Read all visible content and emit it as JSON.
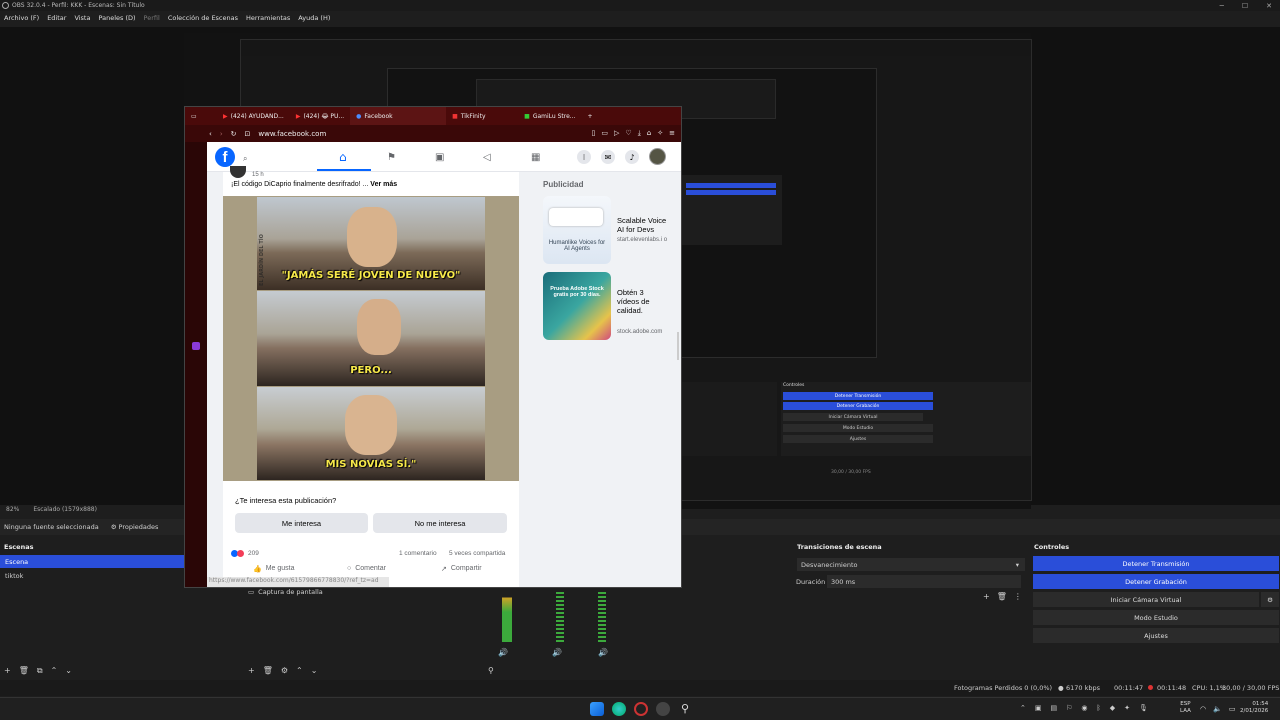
{
  "window": {
    "title": "OBS 32.0.4 - Perfil: KKK - Escenas: Sin Título"
  },
  "menu": [
    "Archivo (F)",
    "Editar",
    "Vista",
    "Paneles (D)",
    "Perfil",
    "Colección de Escenas",
    "Herramientas",
    "Ayuda (H)"
  ],
  "preview_toolbar": {
    "zoom": "82%",
    "scaling": "Escalado (1579x888)"
  },
  "browser": {
    "tabs": [
      "(424) AYUDAND...",
      "(424) 😂 PU...",
      "Facebook",
      "TikFinity",
      "GamiLu Stre..."
    ],
    "url": "www.facebook.com"
  },
  "post": {
    "time": "15 h",
    "text": "¡El código DiCaprio finalmente desrifrado! ...",
    "see_more": "Ver más",
    "captions": [
      "\"JAMÁS SERÉ JOVEN DE NUEVO\"",
      "PERO...",
      "MIS NOVIAS SÍ.\""
    ],
    "watermark": "EL JARDÍN DEL TÍO",
    "question": "¿Te interesa esta publicación?",
    "interested": "Me interesa",
    "not_interested": "No me interesa",
    "reactions": "209",
    "comments": "1 comentario",
    "shares": "5 veces compartida",
    "like": "Me gusta",
    "comment": "Comentar",
    "share": "Compartir",
    "link_preview": "https://www.facebook.com/61579866778830/?ref_tz=ad"
  },
  "ads": {
    "header": "Publicidad",
    "items": [
      {
        "title": "Scalable Voice AI for Devs",
        "source": "start.elevenlabs.i o",
        "img_text": "Humanlike Voices for AI Agents"
      },
      {
        "title": "Obtén 3 vídeos de calidad.",
        "source": "stock.adobe.com",
        "img_text": "Prueba Adobe Stock gratis por 30 días."
      }
    ]
  },
  "sources_bar": {
    "none_selected": "Ninguna fuente seleccionada",
    "properties": "Propiedades"
  },
  "scenes": {
    "header": "Escenas",
    "items": [
      "Escena",
      "tiktok"
    ]
  },
  "sources": {
    "item": "Captura de pantalla"
  },
  "transitions": {
    "header": "Transiciones de escena",
    "type": "Desvanecimiento",
    "duration_label": "Duración",
    "duration": "300 ms"
  },
  "controls": {
    "header": "Controles",
    "stop_stream": "Detener Transmisión",
    "stop_record": "Detener Grabación",
    "virtual_cam": "Iniciar Cámara Virtual",
    "studio_mode": "Modo Estudio",
    "settings": "Ajustes"
  },
  "status": {
    "dropped": "Fotogramas Perdidos 0 (0,0%)",
    "bitrate": "6170 kbps",
    "stream_time": "00:11:47",
    "rec_time": "00:11:48",
    "cpu": "CPU: 1,1%",
    "fps": "30,00 / 30,00 FPS"
  },
  "taskbar": {
    "lang": "ESP",
    "region": "LAA",
    "time": "01:54",
    "date": "2/01/2026"
  },
  "colors": {
    "accent": "#2a4ed9",
    "fb_blue": "#0866ff",
    "dock_bg": "#1e1e1e",
    "browser_tabbar": "#4a0a0a"
  }
}
